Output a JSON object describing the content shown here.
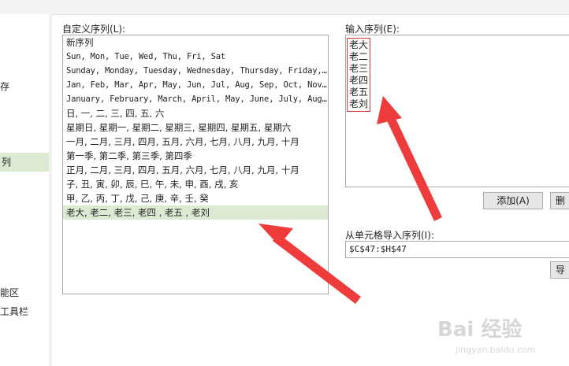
{
  "sidebar": {
    "items": [
      {
        "label": "存"
      },
      {
        "label": "列",
        "selected": true
      },
      {
        "label": "能区"
      },
      {
        "label": "工具栏"
      }
    ]
  },
  "custom_lists": {
    "label": "自定义序列(L):",
    "items": [
      "新序列",
      "Sun, Mon, Tue, Wed, Thu, Fri, Sat",
      "Sunday, Monday, Tuesday, Wednesday, Thursday, Friday, Saturday",
      "Jan, Feb, Mar, Apr, May, Jun, Jul, Aug, Sep, Oct, Nov, Dec",
      "January, February, March, April, May, June, July, August",
      "日, 一, 二, 三, 四, 五, 六",
      "星期日, 星期一, 星期二, 星期三, 星期四, 星期五, 星期六",
      "一月, 二月, 三月, 四月, 五月, 六月, 七月, 八月, 九月, 十月",
      "第一季, 第二季, 第三季, 第四季",
      "正月, 二月, 三月, 四月, 五月, 六月, 七月, 八月, 九月, 十月",
      "子, 丑, 寅, 卯, 辰, 巳, 午, 未, 申, 酉, 戌, 亥",
      "甲, 乙, 丙, 丁, 戊, 己, 庚, 辛, 壬, 癸",
      "老大, 老二, 老三, 老四 , 老五 , 老刘"
    ],
    "selected_index": 12
  },
  "input_entries": {
    "label": "输入序列(E):",
    "lines": [
      "老大",
      "老二",
      "老三",
      "老四",
      "老五",
      "老刘"
    ]
  },
  "buttons": {
    "add": "添加(A)",
    "delete_partial": "删",
    "import_partial": "导"
  },
  "import_range": {
    "label": "从单元格导入序列(I):",
    "value": "$C$47:$H$47"
  },
  "watermark": {
    "text": "Bai 经验",
    "sub": "jingyan.baidu.com"
  },
  "colors": {
    "selection": "#dcead3",
    "highlight_box": "#dd3333",
    "arrow": "#ee3b3b"
  }
}
